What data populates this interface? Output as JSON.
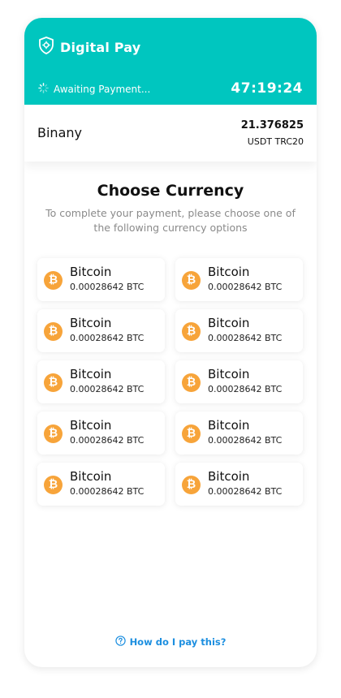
{
  "header": {
    "brand": "Digital Pay",
    "status": "Awaiting Payment...",
    "timer": "47:19:24"
  },
  "merchant": {
    "name": "Binany",
    "amount": "21.376825",
    "currency": "USDT TRC20"
  },
  "chooser": {
    "title": "Choose Currency",
    "subtitle": "To complete your payment, please choose one of the following currency options",
    "options": [
      {
        "name": "Bitcoin",
        "amount": "0.00028642 BTC",
        "icon": "bitcoin-icon"
      },
      {
        "name": "Bitcoin",
        "amount": "0.00028642 BTC",
        "icon": "bitcoin-icon"
      },
      {
        "name": "Bitcoin",
        "amount": "0.00028642 BTC",
        "icon": "bitcoin-icon"
      },
      {
        "name": "Bitcoin",
        "amount": "0.00028642 BTC",
        "icon": "bitcoin-icon"
      },
      {
        "name": "Bitcoin",
        "amount": "0.00028642 BTC",
        "icon": "bitcoin-icon"
      },
      {
        "name": "Bitcoin",
        "amount": "0.00028642 BTC",
        "icon": "bitcoin-icon"
      },
      {
        "name": "Bitcoin",
        "amount": "0.00028642 BTC",
        "icon": "bitcoin-icon"
      },
      {
        "name": "Bitcoin",
        "amount": "0.00028642 BTC",
        "icon": "bitcoin-icon"
      },
      {
        "name": "Bitcoin",
        "amount": "0.00028642 BTC",
        "icon": "bitcoin-icon"
      },
      {
        "name": "Bitcoin",
        "amount": "0.00028642 BTC",
        "icon": "bitcoin-icon"
      }
    ]
  },
  "help": {
    "label": "How do I pay this?"
  },
  "colors": {
    "accent": "#00c6bf",
    "bitcoin": "#f7a43a",
    "link": "#1d8fe0"
  }
}
